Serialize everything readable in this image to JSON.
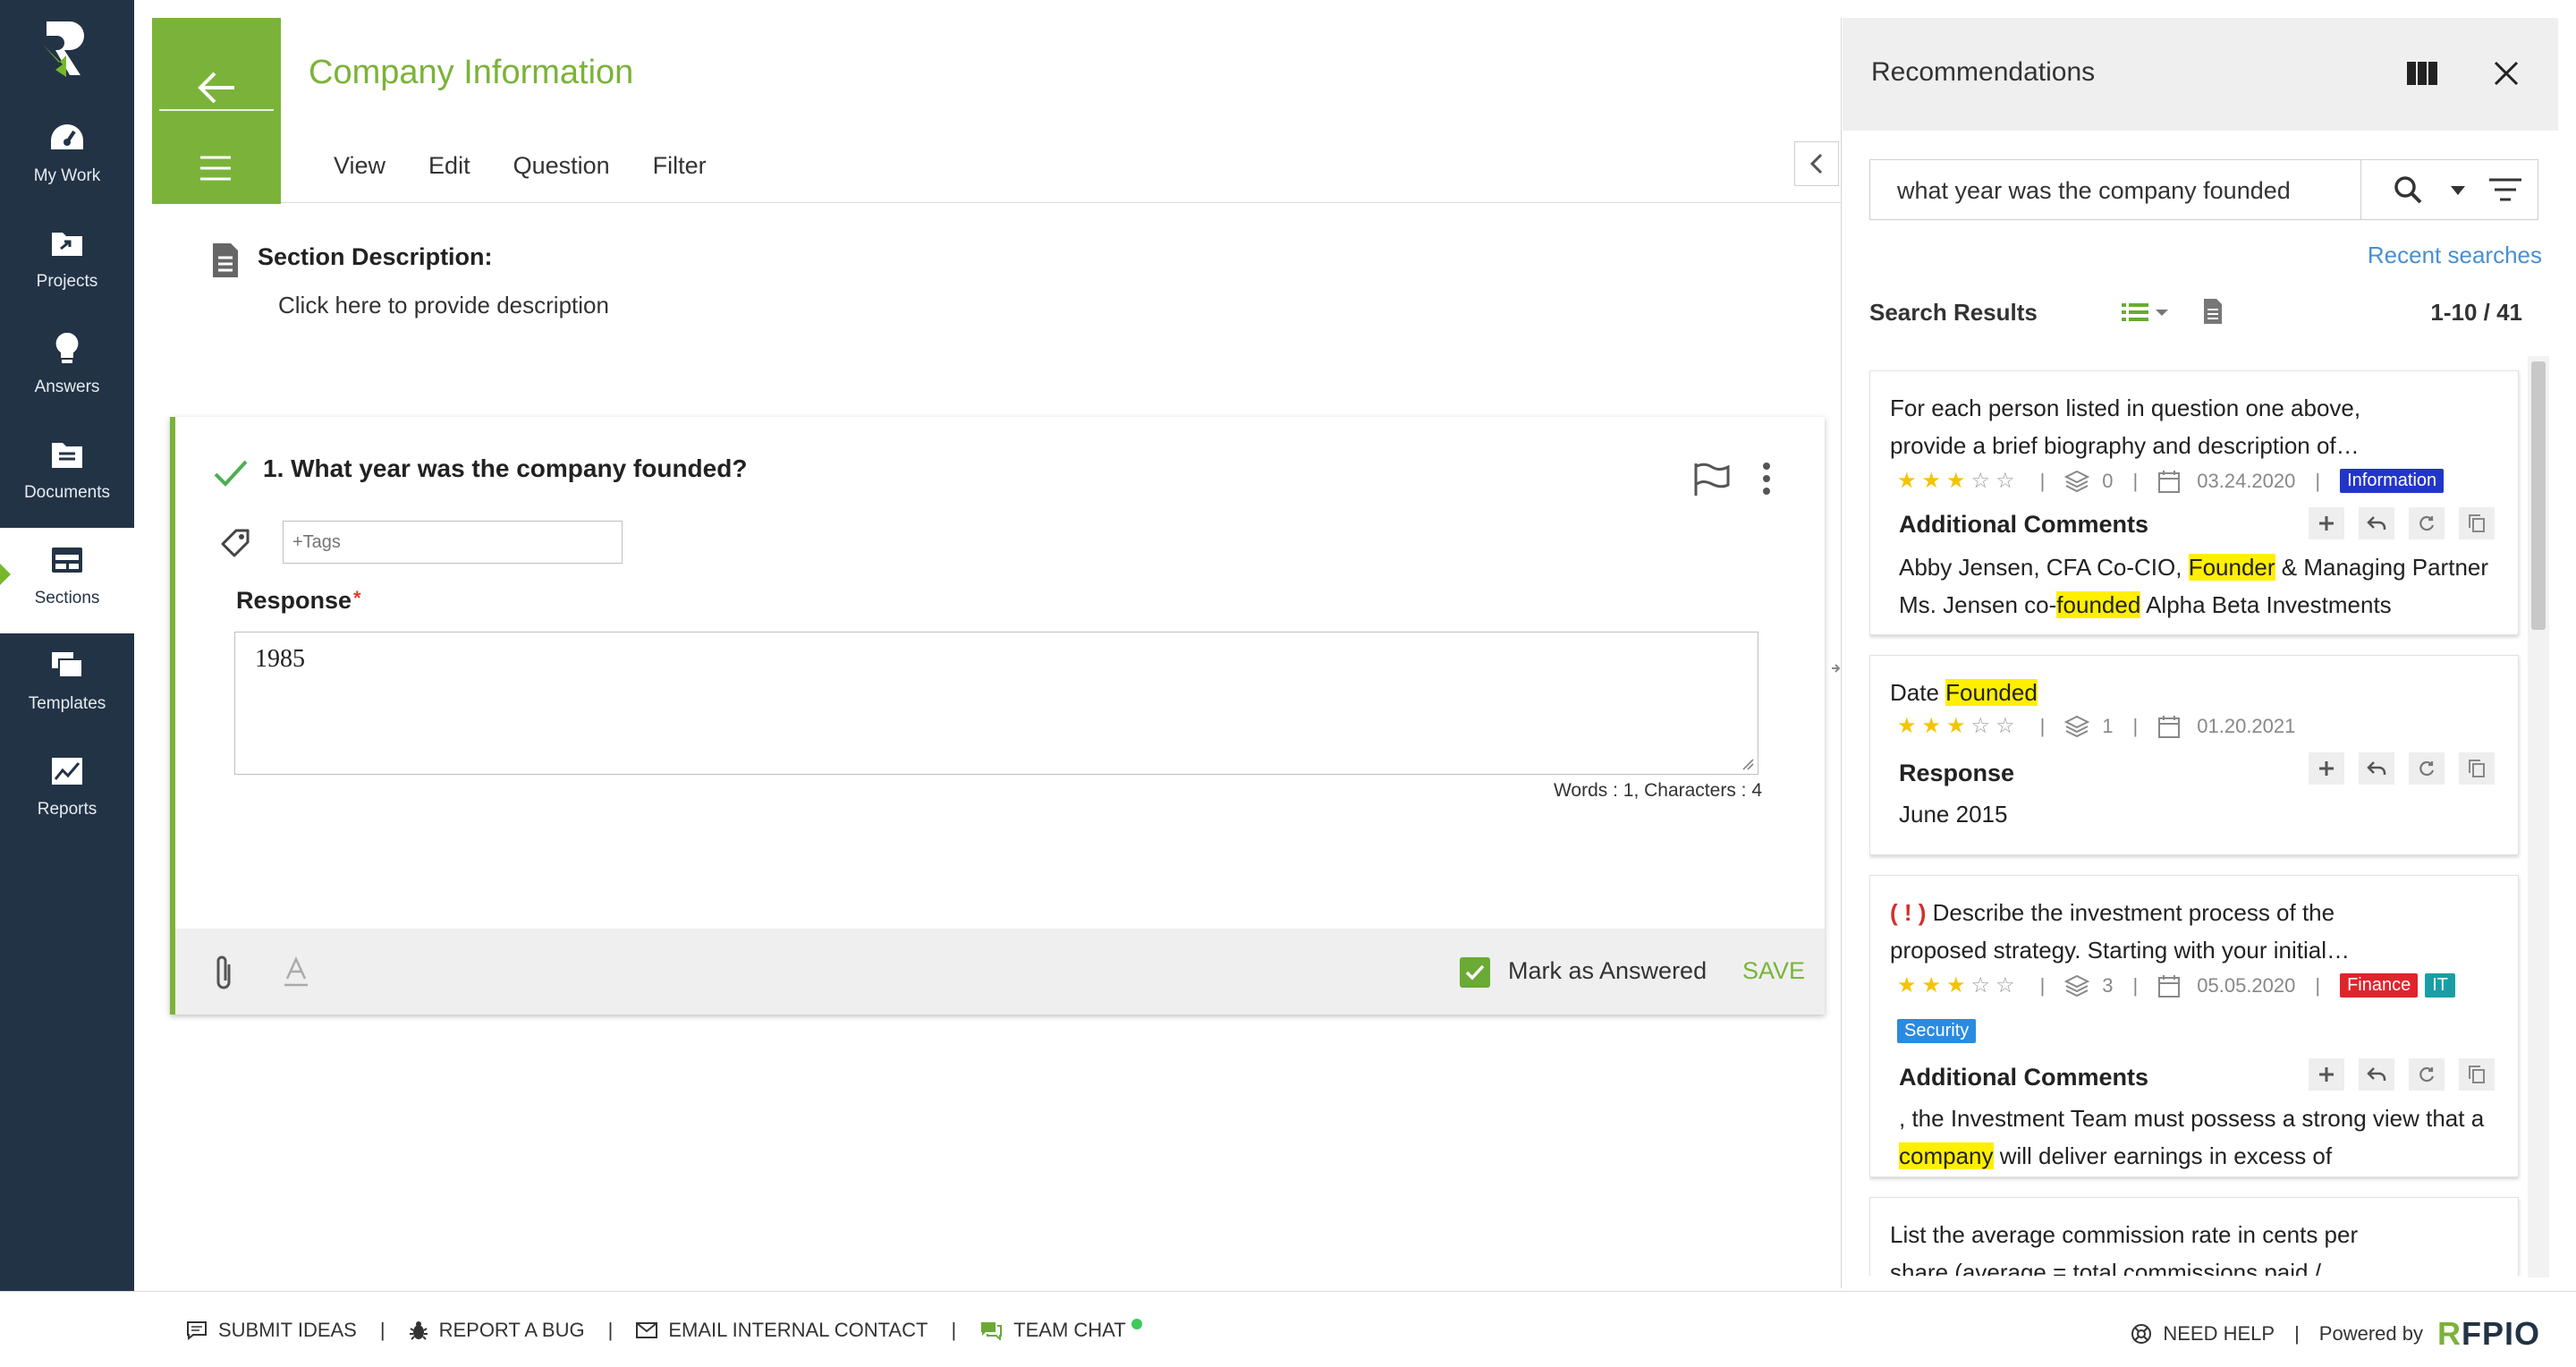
{
  "nav": {
    "items": [
      {
        "label": "My Work",
        "icon": "dashboard-icon"
      },
      {
        "label": "Projects",
        "icon": "projects-folder-icon"
      },
      {
        "label": "Answers",
        "icon": "lightbulb-icon"
      },
      {
        "label": "Documents",
        "icon": "documents-icon"
      },
      {
        "label": "Sections",
        "icon": "sections-icon",
        "active": true
      },
      {
        "label": "Templates",
        "icon": "templates-icon"
      },
      {
        "label": "Reports",
        "icon": "reports-chart-icon"
      }
    ]
  },
  "header": {
    "title": "Company Information",
    "menu": [
      "View",
      "Edit",
      "Question",
      "Filter"
    ]
  },
  "section": {
    "description_label": "Section Description:",
    "description_hint": "Click here to provide description"
  },
  "question": {
    "title": "1. What year was the company founded?",
    "tags_placeholder": "+Tags",
    "response_label": "Response",
    "required_mark": "*",
    "response_value": "1985",
    "wordcount": "Words : 1, Characters : 4",
    "mark_answered_label": "Mark as Answered",
    "save_label": "SAVE"
  },
  "recommendations": {
    "title": "Recommendations",
    "search_value": "what year was the company founded",
    "recent_searches": "Recent searches",
    "results_label": "Search Results",
    "results_count": "1-10 / 41",
    "cards": [
      {
        "title": "For each person listed in question one above, provide a brief biography and description of…",
        "rating": 3,
        "versions": "0",
        "date": "03.24.2020",
        "tags": [
          {
            "label": "Information",
            "color": "#2235c9"
          }
        ],
        "section": "Additional Comments",
        "body_parts": [
          "Abby Jensen, CFA Co-CIO, ",
          "Founder",
          " & Managing Partner Ms. Jensen co-",
          "founded",
          " Alpha Beta Investments"
        ]
      },
      {
        "title_parts": [
          "Date ",
          "Founded"
        ],
        "rating": 3,
        "versions": "1",
        "date": "01.20.2021",
        "section": "Response",
        "body": "June 2015"
      },
      {
        "alert": "( ! )",
        "title": "Describe the investment process of the proposed strategy. Starting with your initial…",
        "rating": 3,
        "versions": "3",
        "date": "05.05.2020",
        "tags": [
          {
            "label": "Finance",
            "color": "#e0242c"
          },
          {
            "label": "IT",
            "color": "#1a9ea6"
          },
          {
            "label": "Security",
            "color": "#2b8be0"
          }
        ],
        "section": "Additional Comments",
        "body_parts": [
          ", the Investment Team must possess a strong view that a ",
          "company",
          " will deliver earnings in excess of"
        ]
      },
      {
        "title": "List the average commission rate in cents per share (average = total commissions paid /…"
      }
    ]
  },
  "footer": {
    "submit_ideas": "SUBMIT IDEAS",
    "report_bug": "REPORT A BUG",
    "email_contact": "EMAIL INTERNAL CONTACT",
    "team_chat": "TEAM CHAT",
    "need_help": "NEED HELP",
    "powered_by": "Powered by",
    "brand_a": "R",
    "brand_b": "FPIO"
  },
  "colors": {
    "accent": "#7bb33a",
    "nav_bg": "#233346",
    "link": "#4a8fd0",
    "highlight": "#ffef00"
  }
}
